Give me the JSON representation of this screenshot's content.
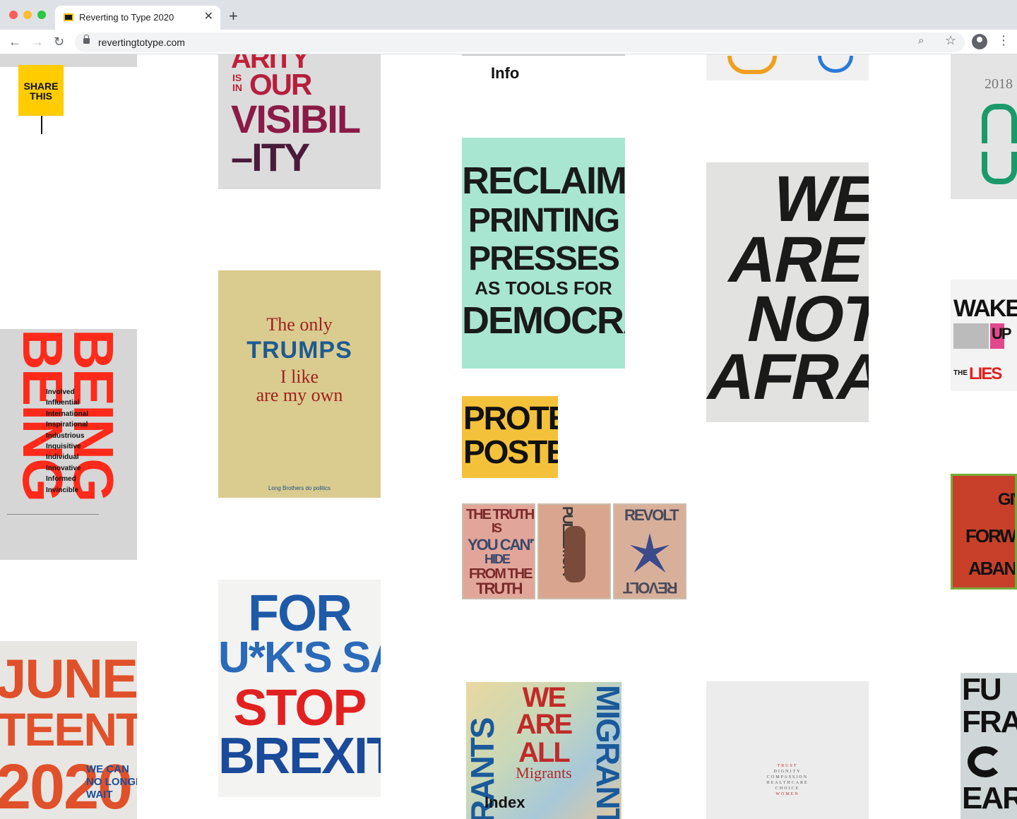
{
  "browser": {
    "tab_title": "Reverting to Type 2020",
    "tab_close": "✕",
    "new_tab": "+",
    "url": "revertingtotype.com",
    "back": "←",
    "forward": "→",
    "reload": "↻",
    "zoom": "⌕",
    "bookmark": "☆",
    "menu": "⋮"
  },
  "nav": {
    "share": "SHARE THIS",
    "info": "Info",
    "index": "Index"
  },
  "posters": {
    "visibility": {
      "line1": "ARITY",
      "line2a": "IS",
      "line2b": "IN",
      "line2c": "OUR",
      "line3": "VISIBIL",
      "line4": "–ITY"
    },
    "being": {
      "words": [
        "Involved",
        "Influential",
        "International",
        "Inspirational",
        "Industrious",
        "Inquisitive",
        "Individual",
        "Innovative",
        "Informed",
        "Invincible"
      ],
      "vert": "BEING"
    },
    "juneteenth": {
      "l1": "JUNE-",
      "l2": "TEENTH",
      "l3": "2020",
      "side1": "WE CAN",
      "side2": "NO LONGER",
      "side3": "WAIT"
    },
    "trumps": {
      "l1": "The only",
      "l2": "TRUMPS",
      "l3": "I like",
      "l4": "are my own",
      "foot": "Long Brothers do politics"
    },
    "brexit": {
      "l1": "FOR",
      "l2": "U*K'S SAKE",
      "l3": "STOP",
      "l4": "BREXIT"
    },
    "reclaim": {
      "l1": "RECLAIM",
      "l2": "PRINTING",
      "l3": "PRESSES",
      "l4": "AS TOOLS FOR",
      "l5": "DEMOCRACY"
    },
    "protest": {
      "l1": "PROTEST",
      "l2": "POSTERS"
    },
    "truth": {
      "a1": "THE TRUTH",
      "a2": "IS",
      "a3": "YOU CAN'T",
      "a4": "HIDE",
      "a5": "FROM THE",
      "a6": "TRUTH",
      "b1": "PULLEMOFF",
      "c1": "REVOLT",
      "c2": "REVOLT"
    },
    "migrants": {
      "l1": "WE",
      "l2": "ARE",
      "l3": "ALL",
      "l4": "Migrants",
      "side1": "MIGRANTS",
      "side2": "RANTS"
    },
    "afraid": {
      "l1": "WE",
      "l2": "ARE",
      "l3": "NOT",
      "l4": "AFRAID"
    },
    "women": {
      "l1": "TRUST",
      "l2": "DIGNITY",
      "l3": "COMPASSION",
      "l4": "HEALTHCARE",
      "l5": "CHOICE",
      "l6": "WOMEN"
    },
    "thai": {
      "year": "2018"
    },
    "wake": {
      "l1": "WAKE",
      "l2": "UP",
      "l3": "THE",
      "l4": "LIES"
    },
    "forward": {
      "l1": "GIV",
      "l2": "FORWAR",
      "l3": "ABANDO"
    },
    "future": {
      "l1": "FU",
      "l2": "FRA",
      "l3": "EART"
    }
  }
}
